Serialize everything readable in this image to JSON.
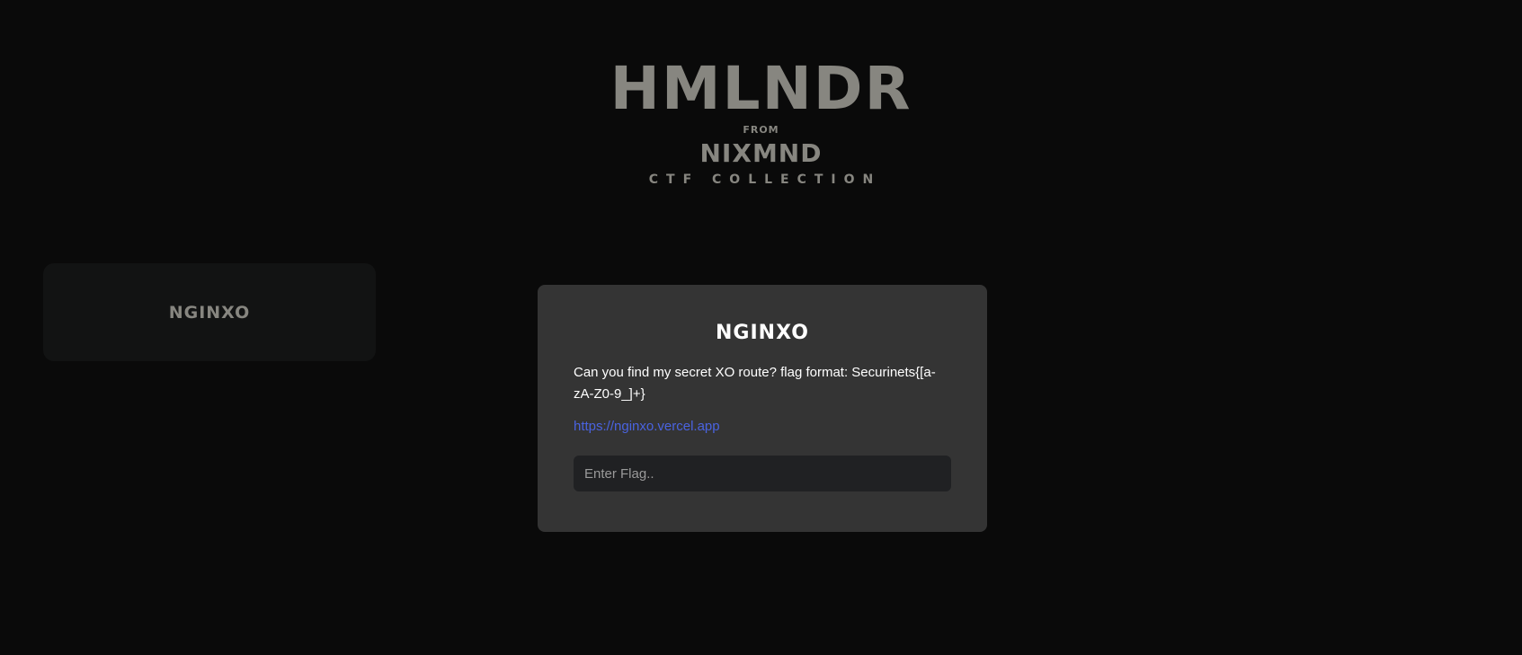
{
  "header": {
    "title": "HMLNDR",
    "from": "FROM",
    "org": "NIXMND",
    "subtitle": "CTF COLLECTION"
  },
  "challenges": [
    {
      "label": "NGINXO"
    }
  ],
  "modal": {
    "title": "NGINXO",
    "description": "Can you find my secret XO route? flag format: Securinets{[a-zA-Z0-9_]+}",
    "link": "https://nginxo.vercel.app",
    "input_placeholder": "Enter Flag.."
  },
  "colors": {
    "background": "#0a0a0a",
    "brand_text": "#878680",
    "tile_bg": "#121313",
    "modal_bg": "#343434",
    "input_bg": "#202123",
    "link": "#4a63e0"
  }
}
